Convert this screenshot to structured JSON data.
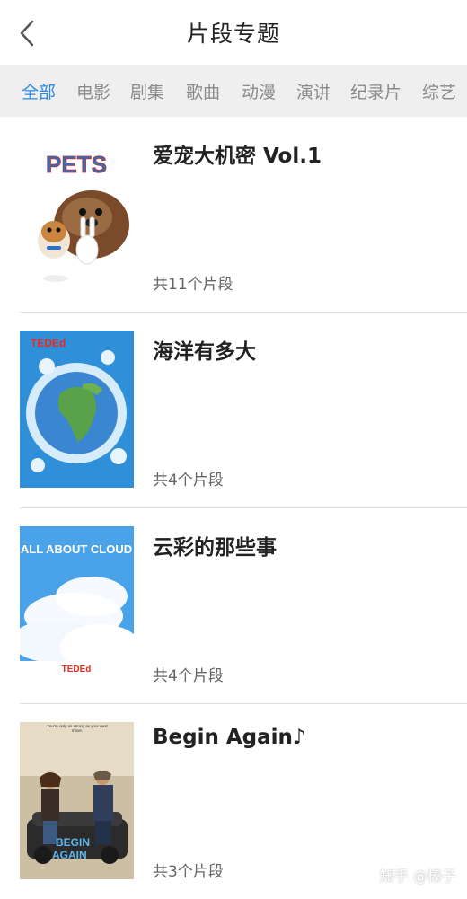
{
  "header": {
    "title": "片段专题"
  },
  "tabs": [
    {
      "label": "全部",
      "active": true
    },
    {
      "label": "电影"
    },
    {
      "label": "剧集"
    },
    {
      "label": "歌曲"
    },
    {
      "label": "动漫"
    },
    {
      "label": "演讲"
    },
    {
      "label": "纪录片"
    },
    {
      "label": "综艺"
    }
  ],
  "items": [
    {
      "title": "爱宠大机密 Vol.1",
      "count": "共11个片段",
      "poster_text": "PETS"
    },
    {
      "title": "海洋有多大",
      "count": "共4个片段",
      "poster_text": "TEDEd"
    },
    {
      "title": "云彩的那些事",
      "count": "共4个片段",
      "poster_text": "ALL ABOUT CLOUD",
      "poster_badge": "TEDEd"
    },
    {
      "title": "Begin Again♪",
      "count": "共3个片段",
      "poster_text": "BEGIN AGAIN",
      "poster_tagline": "You're only as strong as your next move."
    }
  ],
  "watermark": "知乎 @榛子",
  "colors": {
    "accent": "#2b8be6",
    "tab_bar_bg": "#efefef",
    "divider": "#dedede"
  }
}
